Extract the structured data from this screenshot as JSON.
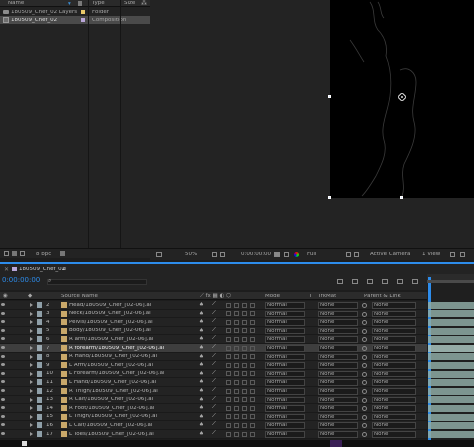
{
  "project": {
    "headers": {
      "name": "Name",
      "type": "Type",
      "size": "Size"
    },
    "items": [
      {
        "name": "180509_Chef_02 Layers",
        "type": "Folder",
        "label_color": "#e8c86a"
      },
      {
        "name": "180509_Chef_02",
        "type": "Composition",
        "label_color": "#b9a6d8"
      }
    ],
    "bpc": "8 bpc"
  },
  "viewer": {
    "zoom": "50%",
    "timecode": "0:00:00:00",
    "resolution": "Full",
    "camera": "Active Camera",
    "view": "1 View"
  },
  "timeline": {
    "tab": "180509_Chef_02",
    "current_time": "0:00:00:00",
    "columns": {
      "source": "Source Name",
      "mode": "Mode",
      "t": "T",
      "trkmat": "TrkMat",
      "parent": "Parent & Link"
    },
    "layers": [
      {
        "num": "2",
        "name": "Head/180509_Chef_[02-06].ai",
        "mode": "Normal",
        "trk": "None",
        "parent": "None",
        "color": "#8f9fa8",
        "selected": false
      },
      {
        "num": "3",
        "name": "Neck/180509_Chef_[02-06].ai",
        "mode": "Normal",
        "trk": "None",
        "parent": "None",
        "color": "#8f9fa8",
        "selected": false
      },
      {
        "num": "4",
        "name": "Pelvis/180509_Chef_[02-06].ai",
        "mode": "Normal",
        "trk": "None",
        "parent": "None",
        "color": "#8f9fa8",
        "selected": false
      },
      {
        "num": "5",
        "name": "Body/180509_Chef_[02-06].ai",
        "mode": "Normal",
        "trk": "None",
        "parent": "None",
        "color": "#8f9fa8",
        "selected": false
      },
      {
        "num": "6",
        "name": "R arm/180509_Chef_[02-06].ai",
        "mode": "Normal",
        "trk": "None",
        "parent": "None",
        "color": "#8f9fa8",
        "selected": false
      },
      {
        "num": "7",
        "name": "R forearm/180509_Chef_[02-06].ai",
        "mode": "Normal",
        "trk": "None",
        "parent": "None",
        "color": "#9aa8b0",
        "selected": true
      },
      {
        "num": "8",
        "name": "R Hand/180509_Chef_[02-06].ai",
        "mode": "Normal",
        "trk": "None",
        "parent": "None",
        "color": "#8f9fa8",
        "selected": false
      },
      {
        "num": "9",
        "name": "L Arm/180509_Chef_[02-06].ai",
        "mode": "Normal",
        "trk": "None",
        "parent": "None",
        "color": "#8f9fa8",
        "selected": false
      },
      {
        "num": "10",
        "name": "L Forearm/180509_Chef_[02-06].ai",
        "mode": "Normal",
        "trk": "None",
        "parent": "None",
        "color": "#8f9fa8",
        "selected": false
      },
      {
        "num": "11",
        "name": "L Hand/180509_Chef_[02-06].ai",
        "mode": "Normal",
        "trk": "None",
        "parent": "None",
        "color": "#8f9fa8",
        "selected": false
      },
      {
        "num": "12",
        "name": "R Thigh/180509_Chef_[02-06].ai",
        "mode": "Normal",
        "trk": "None",
        "parent": "None",
        "color": "#8f9fa8",
        "selected": false
      },
      {
        "num": "13",
        "name": "R Calf/180509_Chef_[02-06].ai",
        "mode": "Normal",
        "trk": "None",
        "parent": "None",
        "color": "#8f9fa8",
        "selected": false
      },
      {
        "num": "14",
        "name": "R Foot/180509_Chef_[02-06].ai",
        "mode": "Normal",
        "trk": "None",
        "parent": "None",
        "color": "#8f9fa8",
        "selected": false
      },
      {
        "num": "15",
        "name": "L Thigh/180509_Chef_[02-06].ai",
        "mode": "Normal",
        "trk": "None",
        "parent": "None",
        "color": "#8f9fa8",
        "selected": false
      },
      {
        "num": "16",
        "name": "L Calf/180509_Chef_[02-06].ai",
        "mode": "Normal",
        "trk": "None",
        "parent": "None",
        "color": "#8f9fa8",
        "selected": false
      },
      {
        "num": "17",
        "name": "L Toes/180509_Chef_[02-06].ai",
        "mode": "Normal",
        "trk": "None",
        "parent": "None",
        "color": "#8f9fa8",
        "selected": false
      }
    ]
  },
  "colors": {
    "accent": "#2d8ceb",
    "timecode": "#2d8ceb",
    "bar": "#8eaaa4"
  }
}
